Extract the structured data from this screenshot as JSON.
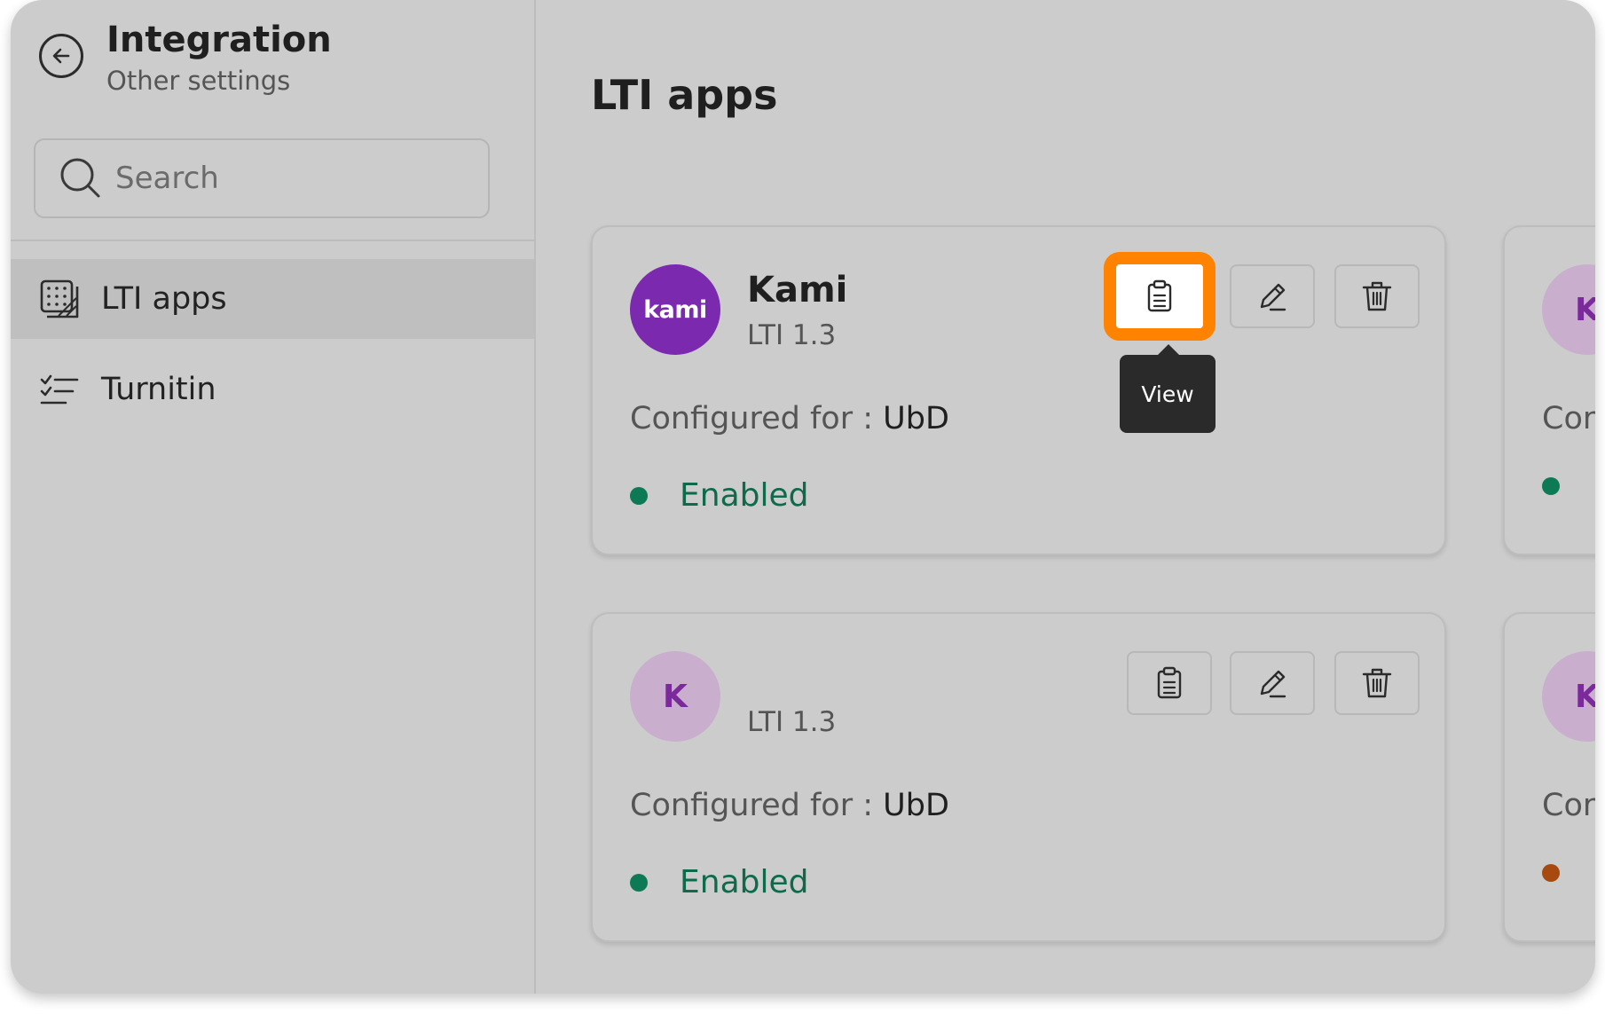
{
  "sidebar": {
    "title": "Integration",
    "subtitle": "Other settings",
    "search_placeholder": "Search",
    "items": [
      {
        "label": "LTI apps",
        "icon": "apps-grid-icon",
        "active": true
      },
      {
        "label": "Turnitin",
        "icon": "checklist-icon",
        "active": false
      }
    ]
  },
  "main": {
    "title": "LTI apps",
    "tooltip": "View",
    "cards": [
      {
        "avatar_text": "kami",
        "name": "Kami",
        "version": "LTI 1.3",
        "configured_label": "Configured for : ",
        "configured_value": "UbD",
        "status": "Enabled",
        "status_color": "#0d7a55"
      },
      {
        "avatar_text": "K",
        "name": "",
        "version": "LTI 1.3",
        "configured_label": "Configured for : ",
        "configured_value": "UbD",
        "status": "Enabled",
        "status_color": "#0d7a55"
      }
    ],
    "partial_cards": [
      {
        "avatar_text": "K",
        "configured_partial": "Cor",
        "status_color": "#0d7a55"
      },
      {
        "avatar_text": "K",
        "configured_partial": "Cor",
        "status_color": "#a84a10"
      }
    ]
  },
  "colors": {
    "accent_highlight": "#ff8200",
    "kami_purple": "#7b2ab0",
    "enabled_green": "#0d7a55",
    "warning_orange": "#a84a10"
  }
}
